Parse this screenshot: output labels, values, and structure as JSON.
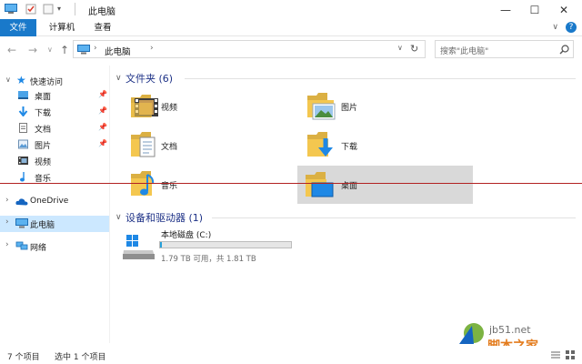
{
  "window": {
    "title": "此电脑"
  },
  "ribbon": {
    "tabs": [
      "文件",
      "计算机",
      "查看"
    ]
  },
  "address": {
    "path_item": "此电脑",
    "search_placeholder": "搜索\"此电脑\""
  },
  "sidebar": {
    "quick_access": "快速访问",
    "items": [
      {
        "label": "桌面",
        "pinned": true
      },
      {
        "label": "下载",
        "pinned": true
      },
      {
        "label": "文档",
        "pinned": true
      },
      {
        "label": "图片",
        "pinned": true
      },
      {
        "label": "视频",
        "pinned": false
      },
      {
        "label": "音乐",
        "pinned": false
      }
    ],
    "onedrive": "OneDrive",
    "this_pc": "此电脑",
    "network": "网络"
  },
  "main": {
    "folders_header": "文件夹 (6)",
    "folders": [
      {
        "label": "视频",
        "icon": "video-folder-icon"
      },
      {
        "label": "图片",
        "icon": "pictures-folder-icon"
      },
      {
        "label": "文档",
        "icon": "documents-folder-icon"
      },
      {
        "label": "下载",
        "icon": "downloads-folder-icon"
      },
      {
        "label": "音乐",
        "icon": "music-folder-icon"
      },
      {
        "label": "桌面",
        "icon": "desktop-folder-icon"
      }
    ],
    "devices_header": "设备和驱动器 (1)",
    "drive": {
      "label": "本地磁盘 (C:)",
      "free_text": "1.79 TB 可用，共 1.81 TB",
      "used_fraction": 0.011
    }
  },
  "status": {
    "count": "7 个项目",
    "selected": "选中 1 个项目"
  },
  "watermark": {
    "site": "jb51.net",
    "name": "脚本之家"
  },
  "colors": {
    "accent": "#1979ca",
    "selection": "#cce8ff",
    "group_header": "#1e3287",
    "folder": "#f4c74f"
  }
}
